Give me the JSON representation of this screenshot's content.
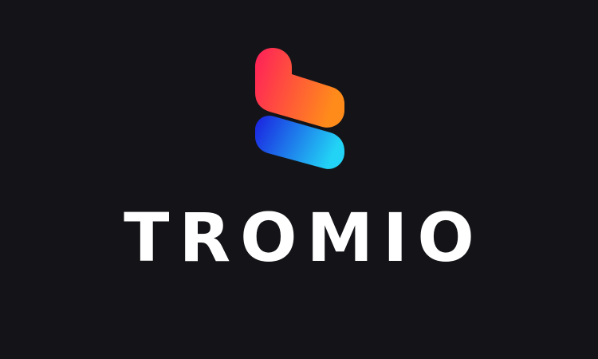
{
  "brand": {
    "name": "TROMIO",
    "logo_icon": "tromio-logo-icon",
    "colors": {
      "background": "#141418",
      "text": "#ffffff",
      "top_gradient_start": "#ff1f5a",
      "top_gradient_end": "#ff8c1a",
      "bottom_gradient_start": "#1a1fe0",
      "bottom_gradient_end": "#22d3f5"
    }
  }
}
